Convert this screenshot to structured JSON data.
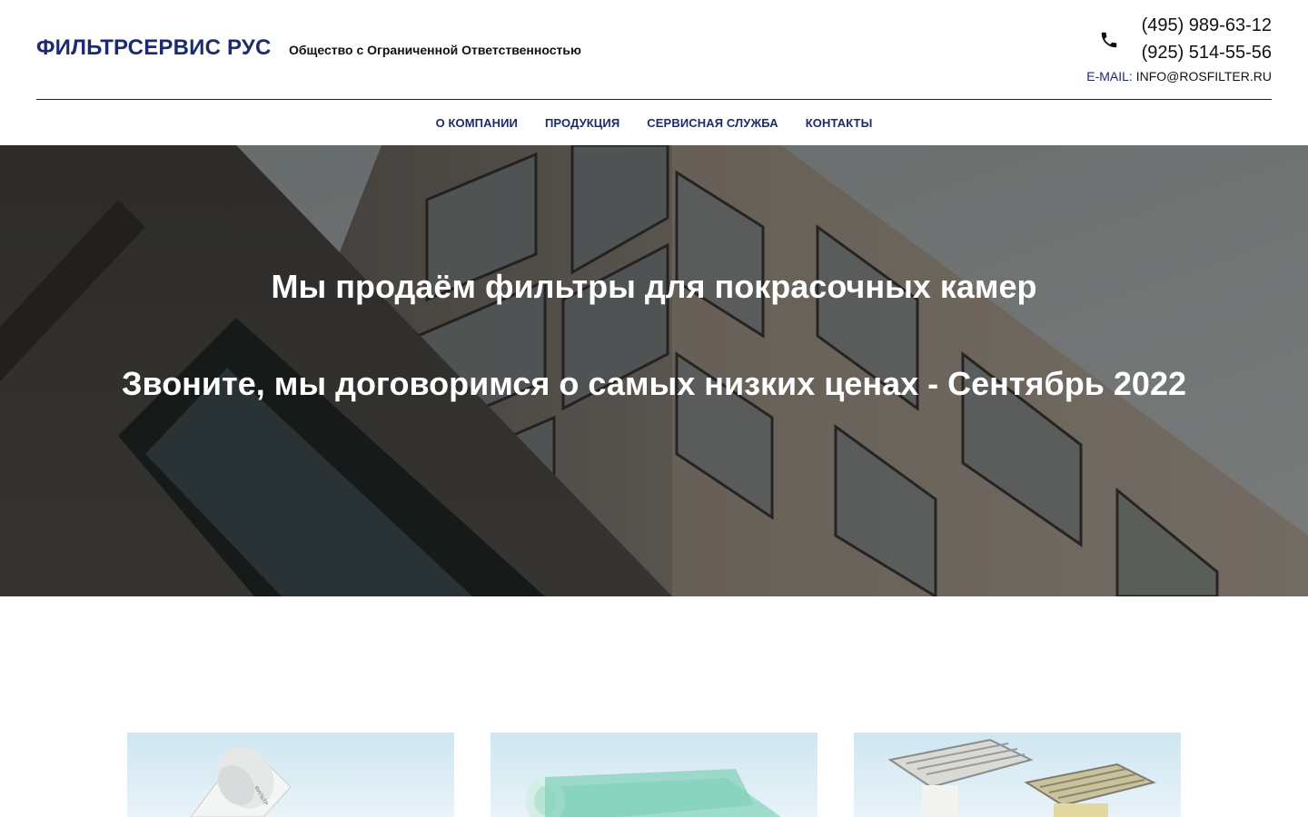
{
  "brand": {
    "name": "ФИЛЬТРСЕРВИС РУС",
    "tagline": "Общество с Ограниченной Ответственностью"
  },
  "contacts": {
    "phone_1": "(495) 989-63-12",
    "phone_2": "(925) 514-55-56",
    "email_label": "E-MAIL:",
    "email_value": "INFO@ROSFILTER.RU",
    "phone_icon": "phone-icon"
  },
  "nav": {
    "items": [
      {
        "label": "О КОМПАНИИ"
      },
      {
        "label": "ПРОДУКЦИЯ"
      },
      {
        "label": "СЕРВИСНАЯ СЛУЖБА"
      },
      {
        "label": "КОНТАКТЫ"
      }
    ]
  },
  "hero": {
    "title": "Мы продаём фильтры для покрасочных камер",
    "subtitle": "Звоните, мы договоримся о самых низких ценах - Сентябрь 2022"
  },
  "products": [
    {
      "image": "ceiling-filter-roll-white"
    },
    {
      "image": "floor-filter-roll-green"
    },
    {
      "image": "pocket-filters"
    }
  ],
  "colors": {
    "brand_navy": "#1d2b6e",
    "text": "#111111",
    "hero_text": "#ffffff"
  }
}
